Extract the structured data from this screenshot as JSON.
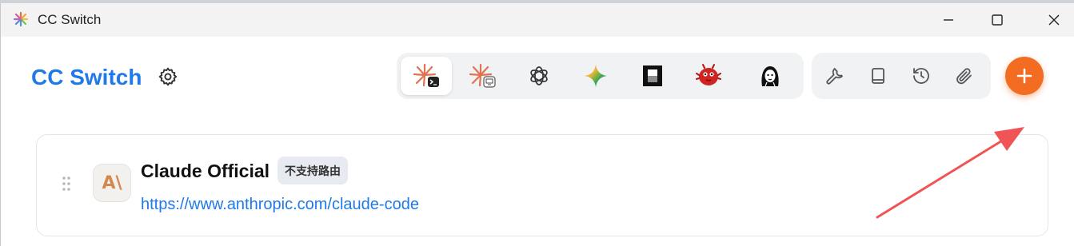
{
  "window": {
    "title": "CC Switch",
    "controls": {
      "minimize": "minimize-icon",
      "maximize": "maximize-icon",
      "close": "close-icon"
    }
  },
  "header": {
    "brand": "CC Switch",
    "settings_icon": "gear-icon",
    "apps": [
      {
        "id": "claude-code",
        "icon": "claude-code-icon",
        "active": true
      },
      {
        "id": "claude-desktop",
        "icon": "claude-desktop-icon",
        "active": false
      },
      {
        "id": "openai",
        "icon": "openai-icon",
        "active": false
      },
      {
        "id": "gemini",
        "icon": "gemini-icon",
        "active": false
      },
      {
        "id": "opencode",
        "icon": "opencode-icon",
        "active": false
      },
      {
        "id": "red-mascot",
        "icon": "red-mascot-icon",
        "active": false
      },
      {
        "id": "avatar-app",
        "icon": "portrait-icon",
        "active": false
      }
    ],
    "tools": [
      {
        "id": "tools",
        "icon": "wrench-icon"
      },
      {
        "id": "docs",
        "icon": "book-icon"
      },
      {
        "id": "history",
        "icon": "history-icon"
      },
      {
        "id": "attach",
        "icon": "paperclip-icon"
      }
    ],
    "add_button_icon": "plus-icon"
  },
  "providers": [
    {
      "name": "Claude Official",
      "badge": "不支持路由",
      "url": "https://www.anthropic.com/claude-code",
      "icon": "anthropic-logo-icon",
      "logo_text": "A\\"
    }
  ],
  "colors": {
    "brand": "#1f7ae8",
    "accent": "#f26d21",
    "annotation_arrow": "#f05454"
  }
}
